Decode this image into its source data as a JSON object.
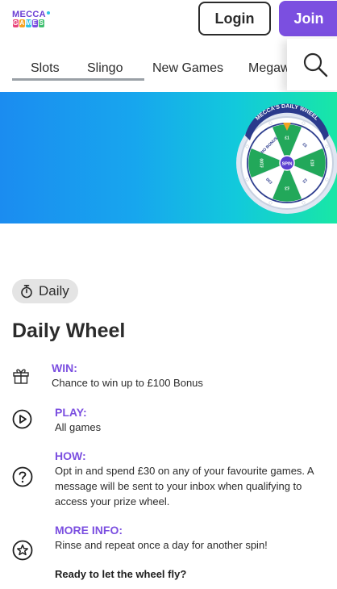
{
  "header": {
    "logo_top": "MECCA",
    "logo_bottom_letters": [
      "G",
      "A",
      "M",
      "E",
      "S"
    ],
    "logo_letter_colors": [
      "#e8457a",
      "#f4a323",
      "#2ec4e6",
      "#7b4fe0",
      "#3fbf6f"
    ],
    "login_label": "Login",
    "join_label": "Join"
  },
  "nav": {
    "tabs": [
      "Slots",
      "Slingo",
      "New Games",
      "Megaw"
    ],
    "search_icon": "search-icon"
  },
  "banner": {
    "wheel_title": "MECCA'S DAILY WHEEL",
    "wheel_center": "SPIN",
    "wheel_segments": [
      "£1",
      "£5",
      "£10",
      "£2",
      "£3",
      "£50",
      "£100",
      "NO BONUS"
    ]
  },
  "content": {
    "chip_label": "Daily",
    "title": "Daily Wheel",
    "sections": [
      {
        "icon": "gift-icon",
        "heading": "WIN:",
        "body": "Chance to win up to £100 Bonus"
      },
      {
        "icon": "play-circle-icon",
        "heading": "PLAY:",
        "body": "All games"
      },
      {
        "icon": "question-circle-icon",
        "heading": "HOW:",
        "body": "Opt in and spend £30 on any of your favourite games. A message will be sent to your inbox when qualifying to access your prize wheel."
      },
      {
        "icon": "star-circle-icon",
        "heading": "MORE INFO:",
        "body": "Rinse and repeat once a day for another spin!"
      }
    ],
    "ready": "Ready to let the wheel fly?"
  },
  "colors": {
    "accent": "#7b4fe0",
    "wheel_green": "#22a85a",
    "wheel_navy": "#2a3a8c"
  }
}
